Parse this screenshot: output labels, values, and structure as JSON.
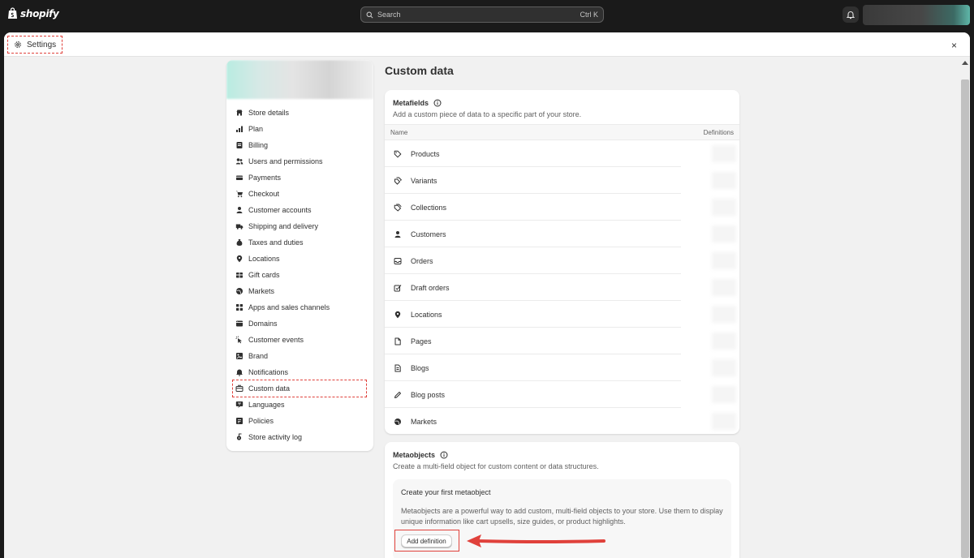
{
  "topbar": {
    "logo_text": "shopify",
    "search_placeholder": "Search",
    "search_shortcut": "Ctrl K"
  },
  "modal": {
    "title": "Settings",
    "close_label": "×"
  },
  "sidebar": {
    "items": [
      {
        "label": "Store details",
        "icon": "store-icon"
      },
      {
        "label": "Plan",
        "icon": "plan-icon"
      },
      {
        "label": "Billing",
        "icon": "billing-icon"
      },
      {
        "label": "Users and permissions",
        "icon": "users-icon"
      },
      {
        "label": "Payments",
        "icon": "payments-icon"
      },
      {
        "label": "Checkout",
        "icon": "cart-icon"
      },
      {
        "label": "Customer accounts",
        "icon": "person-icon"
      },
      {
        "label": "Shipping and delivery",
        "icon": "truck-icon"
      },
      {
        "label": "Taxes and duties",
        "icon": "tax-icon"
      },
      {
        "label": "Locations",
        "icon": "location-icon"
      },
      {
        "label": "Gift cards",
        "icon": "gift-card-icon"
      },
      {
        "label": "Markets",
        "icon": "globe-icon"
      },
      {
        "label": "Apps and sales channels",
        "icon": "apps-icon"
      },
      {
        "label": "Domains",
        "icon": "domain-icon"
      },
      {
        "label": "Customer events",
        "icon": "cursor-icon"
      },
      {
        "label": "Brand",
        "icon": "brand-icon"
      },
      {
        "label": "Notifications",
        "icon": "bell-icon"
      },
      {
        "label": "Custom data",
        "icon": "custom-data-icon"
      },
      {
        "label": "Languages",
        "icon": "language-icon"
      },
      {
        "label": "Policies",
        "icon": "policy-icon"
      },
      {
        "label": "Store activity log",
        "icon": "activity-icon"
      }
    ],
    "active_index": 17
  },
  "main": {
    "title": "Custom data",
    "metafields": {
      "heading": "Metafields",
      "description": "Add a custom piece of data to a specific part of your store.",
      "col_name": "Name",
      "col_definitions": "Definitions",
      "rows": [
        {
          "label": "Products",
          "icon": "tag-icon"
        },
        {
          "label": "Variants",
          "icon": "variants-icon"
        },
        {
          "label": "Collections",
          "icon": "collection-icon"
        },
        {
          "label": "Customers",
          "icon": "person-icon"
        },
        {
          "label": "Orders",
          "icon": "inbox-icon"
        },
        {
          "label": "Draft orders",
          "icon": "draft-icon"
        },
        {
          "label": "Locations",
          "icon": "location-icon"
        },
        {
          "label": "Pages",
          "icon": "page-icon"
        },
        {
          "label": "Blogs",
          "icon": "blog-icon"
        },
        {
          "label": "Blog posts",
          "icon": "pencil-icon"
        },
        {
          "label": "Markets",
          "icon": "globe-icon"
        }
      ]
    },
    "metaobjects": {
      "heading": "Metaobjects",
      "description": "Create a multi-field object for custom content or data structures.",
      "empty_title": "Create your first metaobject",
      "empty_text": "Metaobjects are a powerful way to add custom, multi-field objects to your store. Use them to display unique information like cart upsells, size guides, or product highlights.",
      "button_label": "Add definition"
    }
  },
  "colors": {
    "topbar_bg": "#1a1a1a",
    "page_bg": "#f1f1f1",
    "highlight": "#e0413b"
  }
}
